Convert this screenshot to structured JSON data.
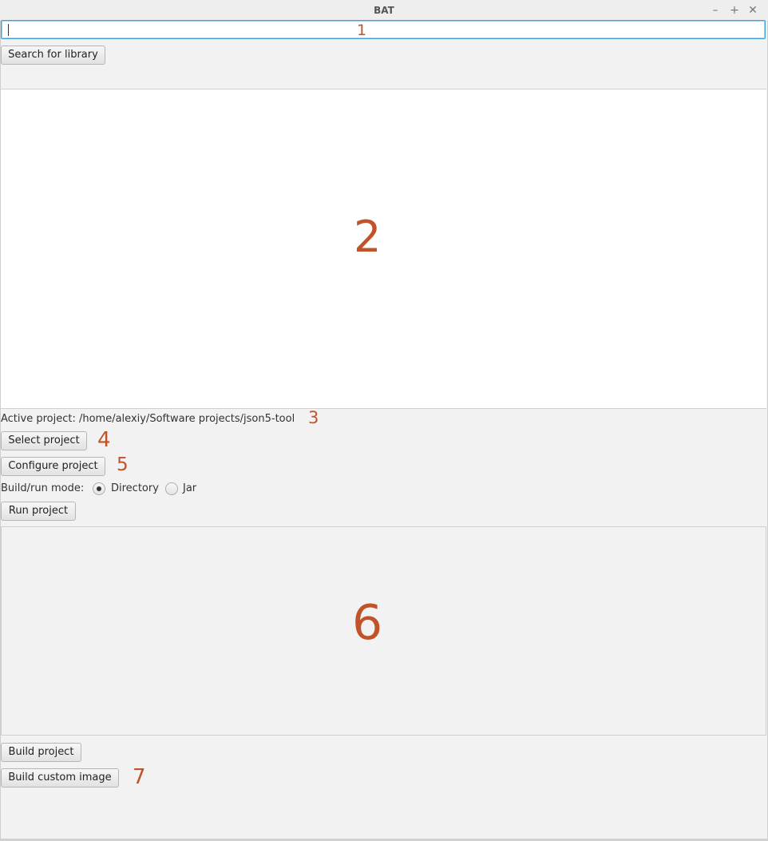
{
  "window": {
    "title": "BAT",
    "minimize_glyph": "–",
    "maximize_glyph": "+",
    "close_glyph": "✕"
  },
  "search": {
    "value": "",
    "button_label": "Search for library"
  },
  "project": {
    "active_label": "Active project: /home/alexiy/Software projects/json5-tool",
    "select_label": "Select project",
    "configure_label": "Configure project",
    "mode_label": "Build/run mode:",
    "mode_options": [
      "Directory",
      "Jar"
    ],
    "mode_selected": "Directory",
    "run_label": "Run project"
  },
  "build": {
    "build_label": "Build project",
    "custom_image_label": "Build custom image"
  },
  "annotations": {
    "a1": "1",
    "a2": "2",
    "a3": "3",
    "a4": "4",
    "a5": "5",
    "a6": "6",
    "a7": "7"
  },
  "colors": {
    "annotation": "#c0532a",
    "focus": "#3ea0d8",
    "background": "#f2f2f2"
  }
}
